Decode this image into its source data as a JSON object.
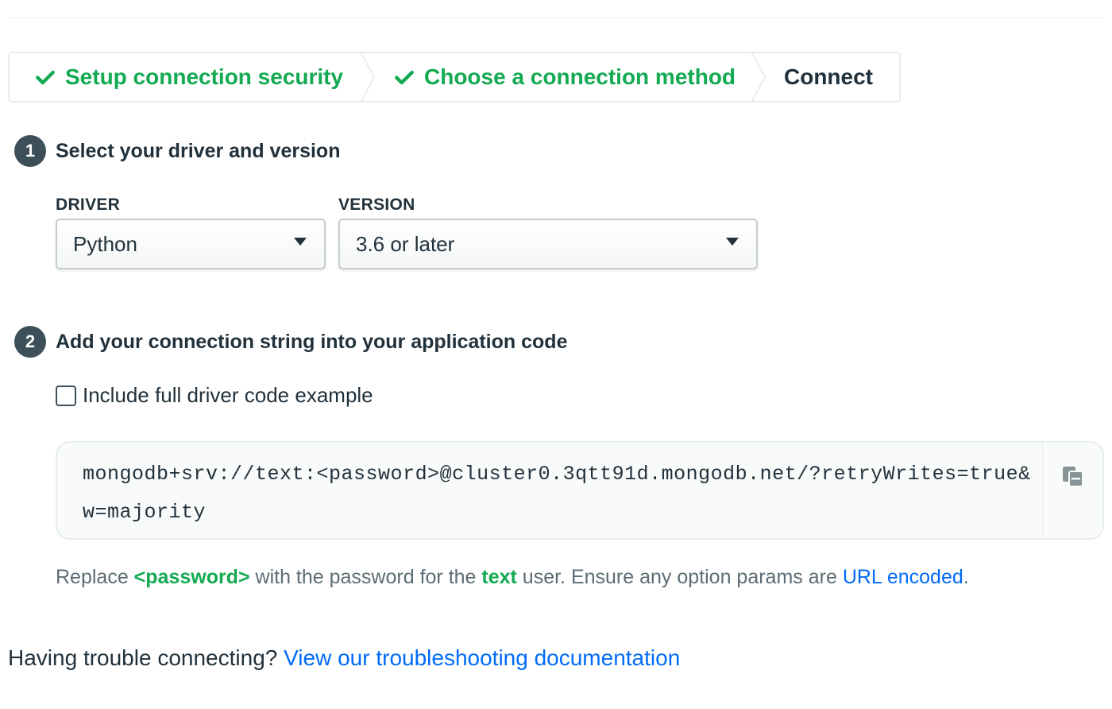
{
  "stepper": {
    "steps": [
      {
        "label": "Setup connection security",
        "status": "complete"
      },
      {
        "label": "Choose a connection method",
        "status": "complete"
      },
      {
        "label": "Connect",
        "status": "current"
      }
    ]
  },
  "section1": {
    "number": "1",
    "title": "Select your driver and version",
    "driver_label": "DRIVER",
    "driver_value": "Python",
    "version_label": "VERSION",
    "version_value": "3.6 or later"
  },
  "section2": {
    "number": "2",
    "title": "Add your connection string into your application code",
    "checkbox_label": "Include full driver code example",
    "checkbox_checked": false,
    "connection_string": "mongodb+srv://text:<password>@cluster0.3qtt91d.mongodb.net/?retryWrites=true&w=majority",
    "copy_icon": "copy-icon"
  },
  "help": {
    "part1": "Replace ",
    "password_token": "<password>",
    "part2": " with the password for the ",
    "username": "text",
    "part3": " user. Ensure any option params are ",
    "link_text": "URL encoded",
    "part4": "."
  },
  "trouble": {
    "text": "Having trouble connecting? ",
    "link_text": "View our troubleshooting documentation"
  },
  "colors": {
    "success_green": "#13aa52",
    "link_blue": "#016bf8",
    "badge_gray": "#3d4f58",
    "text_dark": "#21313c"
  }
}
